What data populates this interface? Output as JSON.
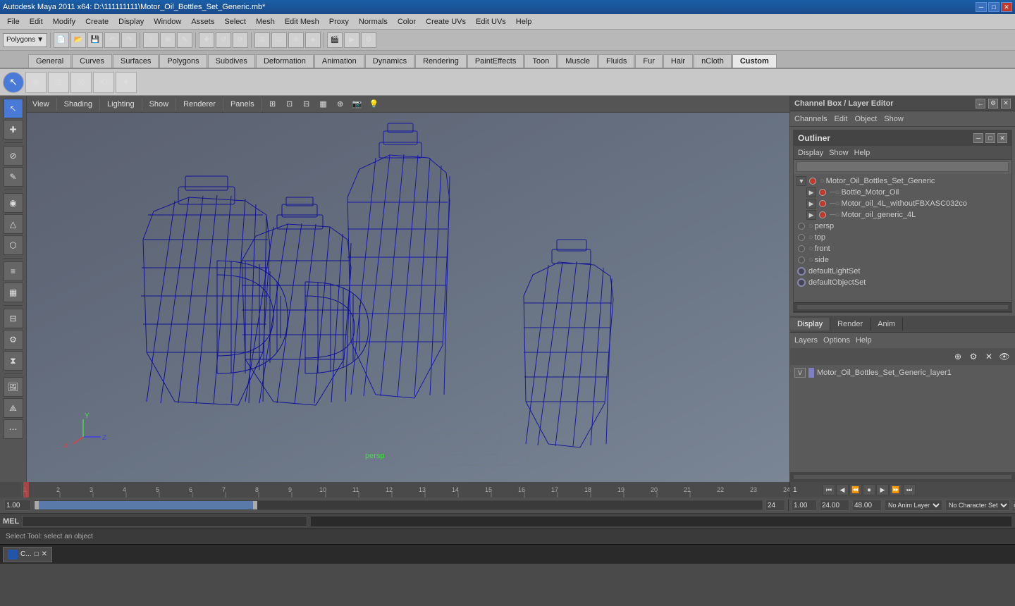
{
  "title": {
    "text": "Autodesk Maya 2011 x64: D:\\111111111\\Motor_Oil_Bottles_Set_Generic.mb*",
    "controls": [
      "─",
      "□",
      "✕"
    ]
  },
  "menubar": {
    "items": [
      "File",
      "Edit",
      "Modify",
      "Create",
      "Display",
      "Window",
      "Assets",
      "Select",
      "Mesh",
      "Edit Mesh",
      "Proxy",
      "Normals",
      "Color",
      "Create UVs",
      "Edit UVs",
      "Help"
    ]
  },
  "toolbar": {
    "dropdown": "Polygons"
  },
  "shelf": {
    "tabs": [
      "General",
      "Curves",
      "Surfaces",
      "Polygons",
      "Subdives",
      "Deformation",
      "Animation",
      "Dynamics",
      "Rendering",
      "PaintEffects",
      "Toon",
      "Muscle",
      "Fluids",
      "Fur",
      "Hair",
      "nCloth",
      "Custom"
    ],
    "active_tab": "Custom"
  },
  "viewport": {
    "menus": [
      "View",
      "Shading",
      "Lighting",
      "Show",
      "Renderer",
      "Panels"
    ]
  },
  "outliner": {
    "title": "Outliner",
    "menu_items": [
      "Display",
      "Show",
      "Help"
    ],
    "tree": [
      {
        "id": "Motor_Oil_Bottles_Set_Generic",
        "level": 0,
        "expanded": true,
        "has_children": true,
        "color": "red"
      },
      {
        "id": "Bottle_Motor_Oil",
        "level": 1,
        "expanded": false,
        "has_children": true,
        "color": "red"
      },
      {
        "id": "Motor_oil_4L_withoutFBXASC032co",
        "level": 1,
        "expanded": false,
        "has_children": true,
        "color": "red"
      },
      {
        "id": "Motor_oil_generic_4L",
        "level": 1,
        "expanded": false,
        "has_children": true,
        "color": "red"
      },
      {
        "id": "persp",
        "level": 0,
        "expanded": false,
        "has_children": false,
        "color": "none"
      },
      {
        "id": "top",
        "level": 0,
        "expanded": false,
        "has_children": false,
        "color": "none"
      },
      {
        "id": "front",
        "level": 0,
        "expanded": false,
        "has_children": false,
        "color": "none"
      },
      {
        "id": "side",
        "level": 0,
        "expanded": false,
        "has_children": false,
        "color": "none"
      },
      {
        "id": "defaultLightSet",
        "level": 0,
        "expanded": false,
        "has_children": false,
        "color": "set"
      },
      {
        "id": "defaultObjectSet",
        "level": 0,
        "expanded": false,
        "has_children": false,
        "color": "set"
      }
    ]
  },
  "channel_box": {
    "title": "Channel Box / Layer Editor",
    "menus": [
      "Channels",
      "Edit",
      "Object",
      "Show"
    ]
  },
  "layers": {
    "tabs": [
      "Display",
      "Render",
      "Anim"
    ],
    "active_tab": "Display",
    "option_menus": [
      "Layers",
      "Options",
      "Help"
    ],
    "items": [
      {
        "v": "V",
        "label": "Motor_Oil_Bottles_Set_Generic_layer1",
        "color": "#8080c0"
      }
    ]
  },
  "timeline": {
    "start": "1",
    "end": "24",
    "current": "1",
    "anim_start": "1.00",
    "anim_end": "24.00",
    "range_end": "48.00",
    "playback": {
      "buttons": [
        "⏮",
        "⏭",
        "⏪",
        "⏩",
        "◀",
        "▶",
        "⏹"
      ]
    },
    "markers": [
      "1",
      "2",
      "3",
      "4",
      "5",
      "6",
      "7",
      "8",
      "9",
      "10",
      "11",
      "12",
      "13",
      "14",
      "15",
      "16",
      "17",
      "18",
      "19",
      "20",
      "21",
      "22",
      "23",
      "24"
    ]
  },
  "statusbar": {
    "time_field": "1.00",
    "anim_end": "24.00",
    "range_end": "48.00",
    "layer_label": "No Anim Layer",
    "charset_label": "No Character Set"
  },
  "commandline": {
    "label": "MEL",
    "input_placeholder": "",
    "output_text": ""
  },
  "helpbar": {
    "text": "Select Tool: select an object"
  },
  "taskbar": {
    "items": [
      "C...",
      "□",
      "✕"
    ]
  },
  "scene": {
    "bottle_color": "#1a1a8a",
    "grid_color": "#555555"
  }
}
